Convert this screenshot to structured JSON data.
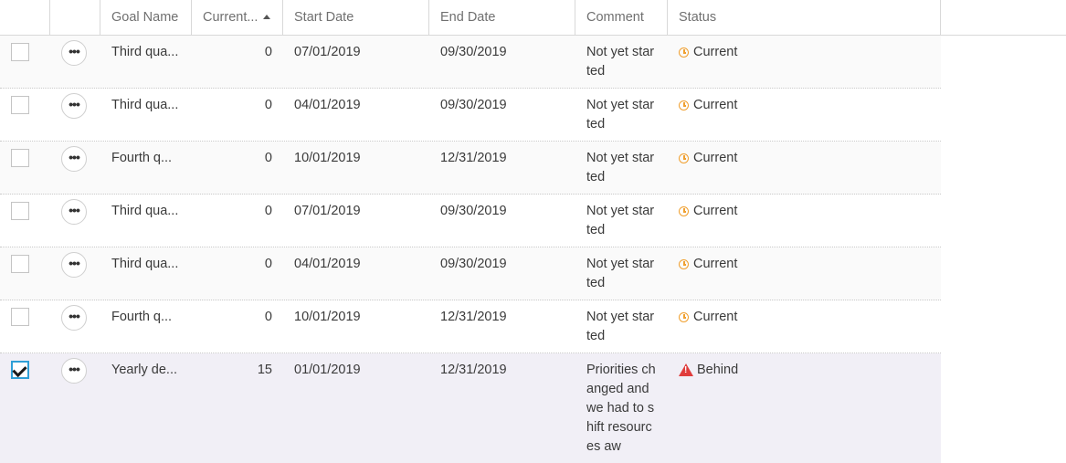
{
  "header": {
    "goal_name": "Goal Name",
    "current": "Current...",
    "start_date": "Start Date",
    "end_date": "End Date",
    "comment": "Comment",
    "status": "Status"
  },
  "colors": {
    "current_status_icon": "#f0a030",
    "behind_status_icon": "#e03b3b",
    "checkbox_checked_border": "#2f9fd6",
    "selected_row_bg": "#f1eff6"
  },
  "icons": {
    "more": "more-icon",
    "current": "clock-icon",
    "behind": "warning-icon",
    "sort": "sort-ascending-icon"
  },
  "rows": [
    {
      "goal_name": "Third qua...",
      "current": "0",
      "start_date": "07/01/2019",
      "end_date": "09/30/2019",
      "comment": "Not yet started",
      "status": "Current",
      "checked": false
    },
    {
      "goal_name": "Third qua...",
      "current": "0",
      "start_date": "04/01/2019",
      "end_date": "09/30/2019",
      "comment": "Not yet started",
      "status": "Current",
      "checked": false
    },
    {
      "goal_name": "Fourth q...",
      "current": "0",
      "start_date": "10/01/2019",
      "end_date": "12/31/2019",
      "comment": "Not yet started",
      "status": "Current",
      "checked": false
    },
    {
      "goal_name": "Third qua...",
      "current": "0",
      "start_date": "07/01/2019",
      "end_date": "09/30/2019",
      "comment": "Not yet started",
      "status": "Current",
      "checked": false
    },
    {
      "goal_name": "Third qua...",
      "current": "0",
      "start_date": "04/01/2019",
      "end_date": "09/30/2019",
      "comment": "Not yet started",
      "status": "Current",
      "checked": false
    },
    {
      "goal_name": "Fourth q...",
      "current": "0",
      "start_date": "10/01/2019",
      "end_date": "12/31/2019",
      "comment": "Not yet started",
      "status": "Current",
      "checked": false
    },
    {
      "goal_name": "Yearly de...",
      "current": "15",
      "start_date": "01/01/2019",
      "end_date": "12/31/2019",
      "comment": "Priorities changed and we had to shift resources aw",
      "status": "Behind",
      "checked": true
    }
  ]
}
